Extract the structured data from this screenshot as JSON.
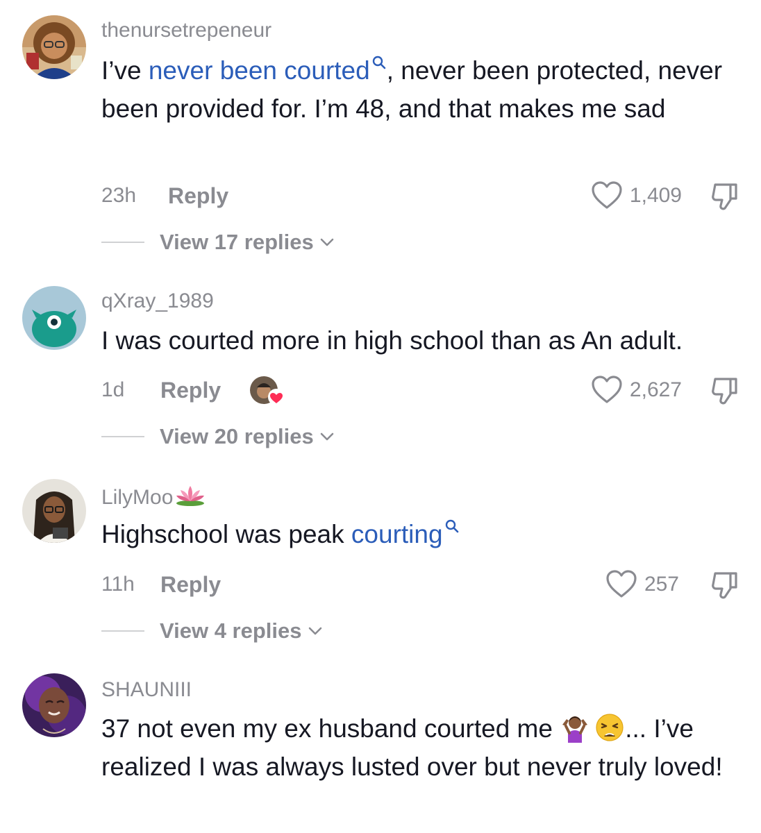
{
  "comments": [
    {
      "username": "thenursetrepeneur",
      "text_pre": "I’ve ",
      "link_text": "never been courted",
      "text_post": ", never been protected, never been provided for. I’m 48, and that makes me sad",
      "time": "23h",
      "reply_label": "Reply",
      "likes": "1,409",
      "view_replies": "View 17 replies"
    },
    {
      "username": "qXray_1989",
      "text": "I was courted more in high school than as An adult.",
      "time": "1d",
      "reply_label": "Reply",
      "likes": "2,627",
      "view_replies": "View 20 replies"
    },
    {
      "username": "LilyMoo",
      "username_emoji": "lotus-emoji",
      "text_pre": "Highschool was peak ",
      "link_text": "courting",
      "time": "11h",
      "reply_label": "Reply",
      "likes": "257",
      "view_replies": "View 4 replies"
    },
    {
      "username": "SHAUNIII",
      "text_pre": "37 not even my ex husband courted me ",
      "emojis": [
        "person-shrugging-emoji",
        "weary-face-emoji"
      ],
      "text_post": "... I’ve realized I was always lusted over but never truly loved!"
    }
  ],
  "colors": {
    "link": "#2b5db9",
    "meta_gray": "#8a8b91",
    "heart_red": "#fe2c55"
  }
}
